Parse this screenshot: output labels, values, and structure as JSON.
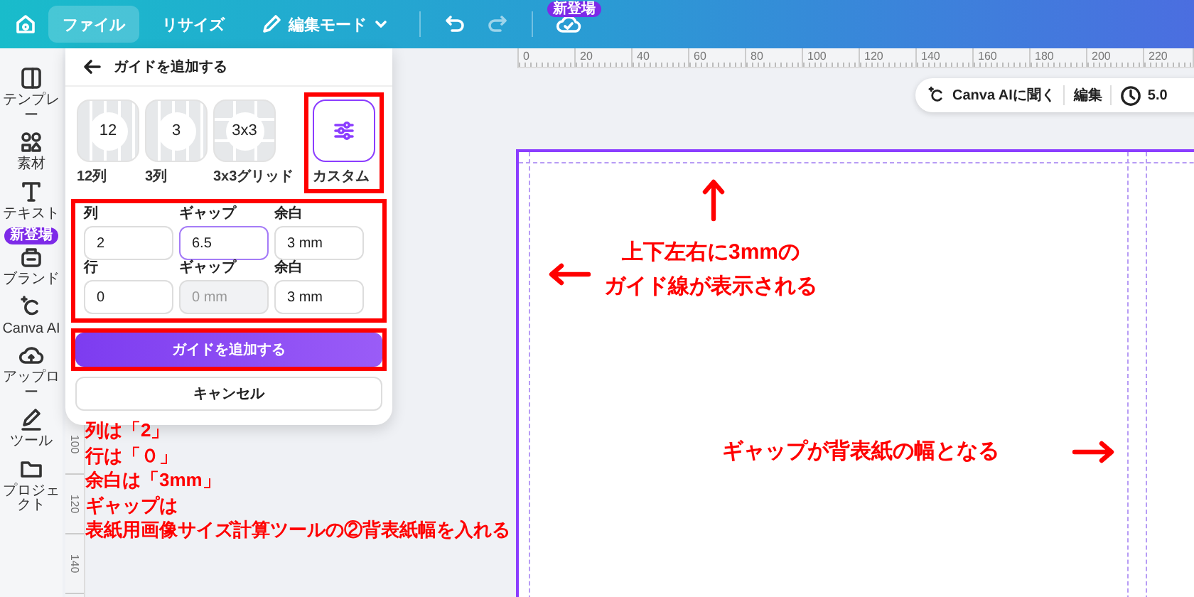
{
  "top_bar": {
    "menu": [
      {
        "label": "ファイル",
        "selected": true,
        "kind": "plain"
      },
      {
        "label": "リサイズ",
        "selected": false,
        "kind": "plain"
      },
      {
        "label": "編集モード",
        "selected": false,
        "kind": "dropdown"
      }
    ],
    "badge": "新登場"
  },
  "sidebar": {
    "items": [
      {
        "label": "テンプレー"
      },
      {
        "label": "素材"
      },
      {
        "label": "テキスト"
      },
      {
        "label": "ブランド",
        "badge": "新登場"
      },
      {
        "label": "Canva AI"
      },
      {
        "label": "アップロー"
      },
      {
        "label": "ツール"
      },
      {
        "label": "プロジェクト"
      }
    ]
  },
  "guide_panel": {
    "title": "ガイドを追加する",
    "presets": [
      {
        "label": "12",
        "caption": "12列",
        "kind": "columns",
        "selected": false,
        "highlighted": false
      },
      {
        "label": "3",
        "caption": "3列",
        "kind": "columns",
        "selected": false,
        "highlighted": false
      },
      {
        "label": "3x3",
        "caption": "3x3グリッド",
        "kind": "grid",
        "selected": false,
        "highlighted": false
      },
      {
        "caption": "カスタム",
        "kind": "custom",
        "selected": true,
        "highlighted": true
      }
    ],
    "fields_highlighted": true,
    "rows": [
      {
        "fields": [
          {
            "label": "列",
            "value": "2",
            "focused": false,
            "disabled": false
          },
          {
            "label": "ギャップ",
            "value": "6.5",
            "focused": true,
            "disabled": false
          },
          {
            "label": "余白",
            "value": "3 mm",
            "focused": false,
            "disabled": false
          }
        ]
      },
      {
        "fields": [
          {
            "label": "行",
            "value": "0",
            "focused": false,
            "disabled": false
          },
          {
            "label": "ギャップ",
            "placeholder": "0 mm",
            "focused": false,
            "disabled": true
          },
          {
            "label": "余白",
            "value": "3 mm",
            "focused": false,
            "disabled": false
          }
        ]
      }
    ],
    "buttons": [
      {
        "label": "ガイドを追加する",
        "kind": "primary",
        "highlighted": true
      },
      {
        "label": "キャンセル",
        "kind": "secondary",
        "highlighted": false
      }
    ]
  },
  "rulers": {
    "horizontal": [
      "0",
      "20",
      "40",
      "60",
      "80",
      "100",
      "120",
      "140",
      "160",
      "180",
      "200",
      "220"
    ],
    "vertical": [
      "100",
      "120",
      "140"
    ]
  },
  "canvas_toolbar": {
    "items": [
      "Canva AIに聞く",
      "編集",
      "5.0"
    ]
  },
  "annotations": {
    "notes": [
      "列は「2」",
      "行は「０」",
      "余白は「3mm」",
      "ギャップは",
      "表紙用画像サイズ計算ツールの②背表紙幅を入れる"
    ],
    "callouts": [
      {
        "lines": [
          "上下左右に3mmの",
          "ガイド線が表示される"
        ]
      },
      {
        "lines": [
          "ギャップが背表紙の幅となる"
        ]
      }
    ]
  }
}
